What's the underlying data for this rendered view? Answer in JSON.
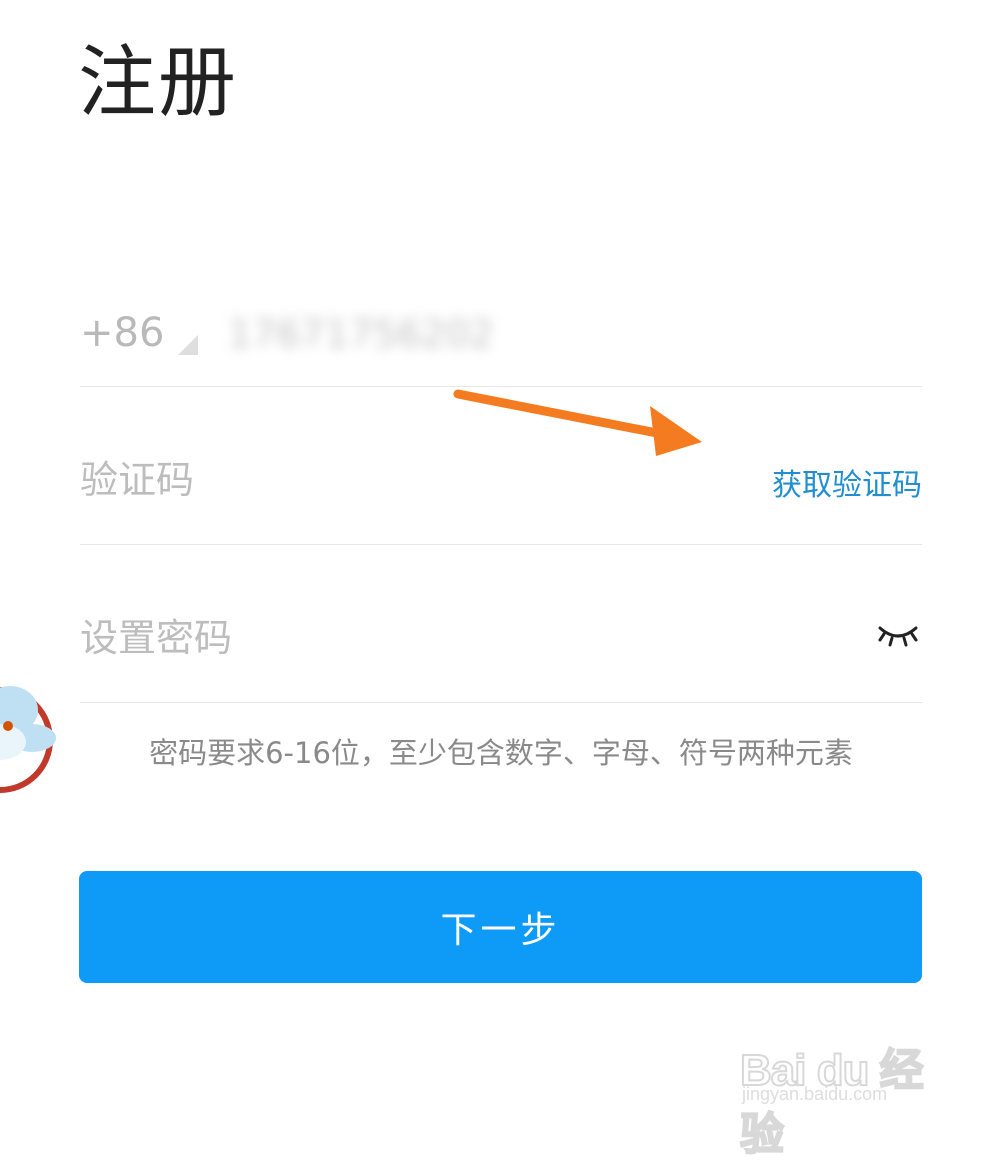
{
  "page": {
    "title": "注册"
  },
  "phone": {
    "country_code": "+86",
    "number": "17671756202"
  },
  "verification": {
    "placeholder": "验证码",
    "get_code_label": "获取验证码"
  },
  "password": {
    "placeholder": "设置密码",
    "toggle_icon": "eye-closed-icon"
  },
  "hint": "密码要求6-16位，至少包含数字、字母、符号两种元素",
  "next_button_label": "下一步",
  "watermark": {
    "logo": "Bai du 经验",
    "url": "jingyan.baidu.com"
  },
  "colors": {
    "accent": "#0e9bf7",
    "link": "#1f8fd0",
    "annotation_arrow": "#f47b20"
  }
}
